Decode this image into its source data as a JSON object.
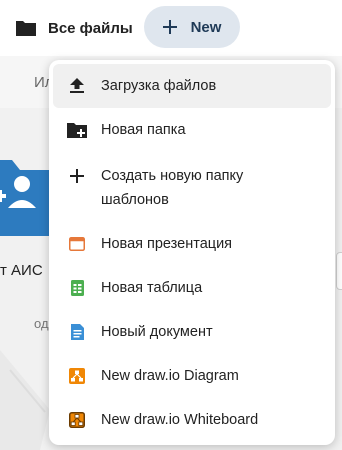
{
  "breadcrumb": {
    "label": "Все файлы",
    "icon": "folder-icon"
  },
  "new_button": {
    "icon": "plus-icon",
    "label": "New"
  },
  "background": {
    "subbar_text": "Ил",
    "card_label": "т АИС",
    "card_sub": "од"
  },
  "menu": {
    "items": [
      {
        "label": "Загрузка файлов",
        "icon": "upload-icon"
      },
      {
        "label": "Новая папка",
        "icon": "folder-plus-icon"
      },
      {
        "label": "Создать новую папку шаблонов",
        "icon": "plus-icon"
      },
      {
        "label": "Новая презентация",
        "icon": "presentation-icon",
        "color": "#e6783a"
      },
      {
        "label": "Новая таблица",
        "icon": "spreadsheet-icon",
        "color": "#4caf50"
      },
      {
        "label": "Новый документ",
        "icon": "document-icon",
        "color": "#3a8fd6"
      },
      {
        "label": "New draw.io Diagram",
        "icon": "drawio-diagram-icon",
        "color": "#f08705"
      },
      {
        "label": "New draw.io Whiteboard",
        "icon": "drawio-whiteboard-icon",
        "color": "#f08705"
      }
    ]
  },
  "colors": {
    "accent_button_bg": "#dfe6ee",
    "folder_blue": "#2d7bbf"
  }
}
